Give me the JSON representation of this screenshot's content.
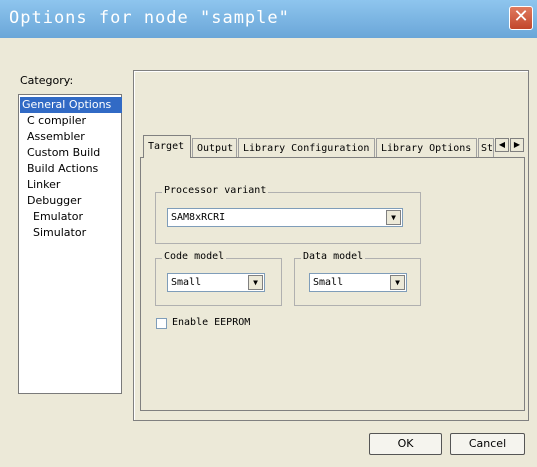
{
  "window": {
    "title": "Options for node \"sample\"",
    "close_glyph": "✕"
  },
  "category": {
    "label": "Category:",
    "items": [
      "General Options",
      "C compiler",
      "Assembler",
      "Custom Build",
      "Build Actions",
      "Linker",
      "Debugger",
      "Emulator",
      "Simulator"
    ],
    "selected": "General Options"
  },
  "tabs": [
    "Target",
    "Output",
    "Library Configuration",
    "Library Options",
    "St"
  ],
  "active_tab": "Target",
  "scroll": {
    "left_glyph": "◀",
    "right_glyph": "▶"
  },
  "processor": {
    "group_label": "Processor variant",
    "value": "SAM8xRCRI"
  },
  "code_model": {
    "group_label": "Code model",
    "value": "Small"
  },
  "data_model": {
    "group_label": "Data model",
    "value": "Small"
  },
  "eeprom": {
    "label": "Enable EEPROM",
    "checked": false
  },
  "buttons": {
    "ok": "OK",
    "cancel": "Cancel"
  },
  "icons": {
    "dropdown": "chevron-down-icon",
    "close": "close-icon"
  }
}
